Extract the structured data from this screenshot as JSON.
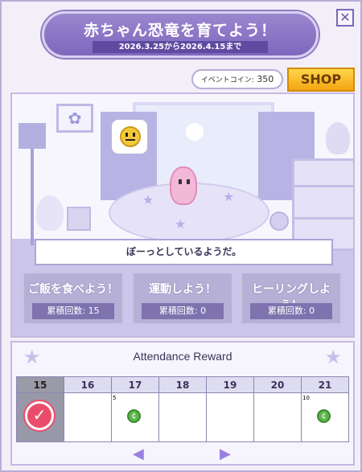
{
  "header": {
    "title": "赤ちゃん恐竜を育てよう！",
    "period": "2026.3.25から2026.4.15まで",
    "close_icon": "✕"
  },
  "currency": {
    "label": "イベントコイン:",
    "value": "350"
  },
  "shop": {
    "label": "SHOP"
  },
  "scene": {
    "mood_icon": "neutral-face-icon",
    "status_text": "ぼーっとしているようだ。"
  },
  "actions": [
    {
      "label": "ご飯を食べよう！",
      "count_label": "累積回数: 15"
    },
    {
      "label": "運動しよう！",
      "count_label": "累積回数: 0"
    },
    {
      "label": "ヒーリングしよう！",
      "count_label": "累積回数: 0"
    }
  ],
  "attendance": {
    "title": "Attendance Reward",
    "days": [
      {
        "day": "15",
        "state": "today-checked",
        "bonus": ""
      },
      {
        "day": "16",
        "state": "empty",
        "bonus": ""
      },
      {
        "day": "17",
        "state": "reward",
        "bonus": "5"
      },
      {
        "day": "18",
        "state": "empty",
        "bonus": ""
      },
      {
        "day": "19",
        "state": "empty",
        "bonus": ""
      },
      {
        "day": "20",
        "state": "empty",
        "bonus": ""
      },
      {
        "day": "21",
        "state": "reward",
        "bonus": "10"
      }
    ]
  },
  "colors": {
    "accent": "#8d7bc4",
    "shop": "#f4a413",
    "stamp": "#ea4d6c",
    "reward_coin": "#5bb54a"
  }
}
